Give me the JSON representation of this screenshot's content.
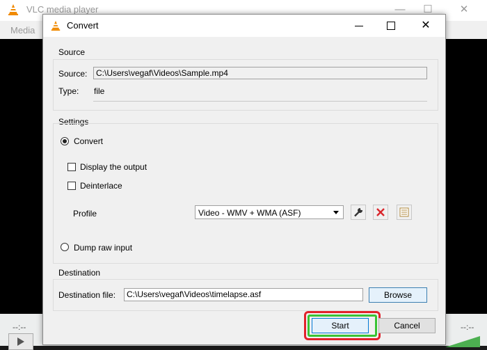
{
  "vlc": {
    "title": "VLC media player",
    "menu_media": "Media",
    "time_left": "--:--",
    "time_right": "--:--"
  },
  "dialog": {
    "title": "Convert",
    "close_glyph": "✕",
    "source": {
      "group_label": "Source",
      "source_label": "Source:",
      "source_value": "C:\\Users\\vegaf\\Videos\\Sample.mp4",
      "type_label": "Type:",
      "type_value": "file"
    },
    "settings": {
      "group_label": "Settings",
      "convert_label": "Convert",
      "convert_selected": true,
      "display_output_label": "Display the output",
      "deinterlace_label": "Deinterlace",
      "profile_label": "Profile",
      "profile_value": "Video - WMV + WMA (ASF)",
      "dump_raw_label": "Dump raw input"
    },
    "destination": {
      "group_label": "Destination",
      "file_label": "Destination file:",
      "file_value": "C:\\Users\\vegaf\\Videos\\timelapse.asf",
      "browse_label": "Browse"
    },
    "buttons": {
      "start_label": "Start",
      "cancel_label": "Cancel"
    }
  },
  "colors": {
    "highlight_outer": "#e2222b",
    "highlight_inner": "#39c335",
    "delete_icon": "#d9262c"
  }
}
